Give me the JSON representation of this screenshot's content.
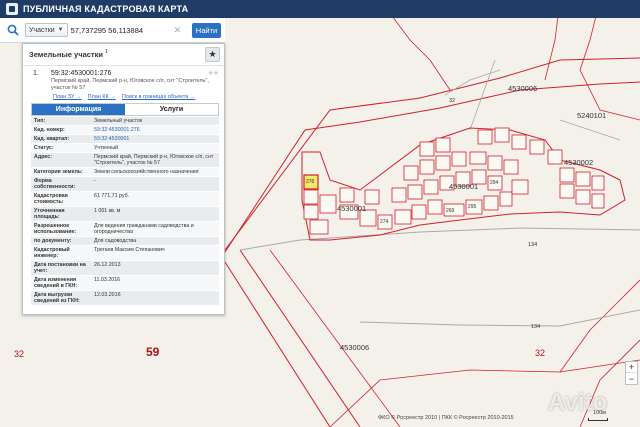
{
  "header": {
    "title": "ПУБЛИЧНАЯ КАДАСТРОВАЯ КАРТА",
    "logo_icon": "map-logo-icon"
  },
  "search": {
    "type_label": "Участки",
    "value": "57,737295 56,113884",
    "button_label": "Найти"
  },
  "panel": {
    "title": "Земельные участки",
    "count": "1",
    "result": {
      "index": "1.",
      "cad_number": "59:32:4530001:276",
      "address": "Пермский край, Пермский р-н, Юговское с/п, снт \"Строитель\", участок № 57"
    },
    "links": [
      "План ЗУ →",
      "План КК →",
      "Поиск в границах объекта →"
    ],
    "tabs": {
      "info": "Информация",
      "services": "Услуги"
    },
    "rows": [
      {
        "label": "Тип:",
        "value": "Земельный участок"
      },
      {
        "label": "Кад. номер:",
        "value": "59:32:4530001:276",
        "link": true
      },
      {
        "label": "Кад. квартал:",
        "value": "59:32:4530001",
        "link": true
      },
      {
        "label": "Статус:",
        "value": "Учтенный"
      },
      {
        "label": "Адрес:",
        "value": "Пермский край, Пермский р-н, Юговское с/п, снт \"Строитель\", участок № 57"
      },
      {
        "label": "Категория земель:",
        "value": "Земли сельскохозяйственного назначения"
      },
      {
        "label": "Форма собственности:",
        "value": "-"
      },
      {
        "label": "Кадастровая стоимость:",
        "value": "61 771,71 руб."
      },
      {
        "label": "Уточненная площадь:",
        "value": "1 001 кв. м"
      },
      {
        "label": "Разрешенное использование:",
        "value": "Для ведения гражданами садоводства и огородничества"
      },
      {
        "label": "по документу:",
        "value": "Для садоводства"
      },
      {
        "label": "Кадастровый инженер:",
        "value": "Трегаев Максим Степанович"
      },
      {
        "label": "Дата постановки на учет:",
        "value": "26.12.2013"
      },
      {
        "label": "Дата изменения сведений в ГКН:",
        "value": "11.03.2016"
      },
      {
        "label": "Дата выгрузки сведений из ГКН:",
        "value": "12.03.2016"
      }
    ]
  },
  "map": {
    "labels": {
      "num_59": "59",
      "num_32_left": "32",
      "num_32_right": "32",
      "q4530006_top": "4530006",
      "q4530006_bottom": "4530006",
      "q5240101": "5240101",
      "q4530002": "4530002",
      "q4530001": "4530001",
      "q4530001b": "4530001",
      "p32": "32",
      "p134a": "134",
      "p134b": "134",
      "p276": "276",
      "p274": "274",
      "p295": "295",
      "p294": "294",
      "p269": "269"
    },
    "zoom_in": "+",
    "zoom_out": "−",
    "footer": "ФКО © Росреестр 2010 | ПКК © Росреестр 2010-2015",
    "scale": "100м",
    "watermark": "Avito"
  },
  "colors": {
    "boundary": "#d41f2a",
    "selected": "#f3e96a",
    "header": "#1e3c66",
    "accent": "#2d72c2"
  }
}
